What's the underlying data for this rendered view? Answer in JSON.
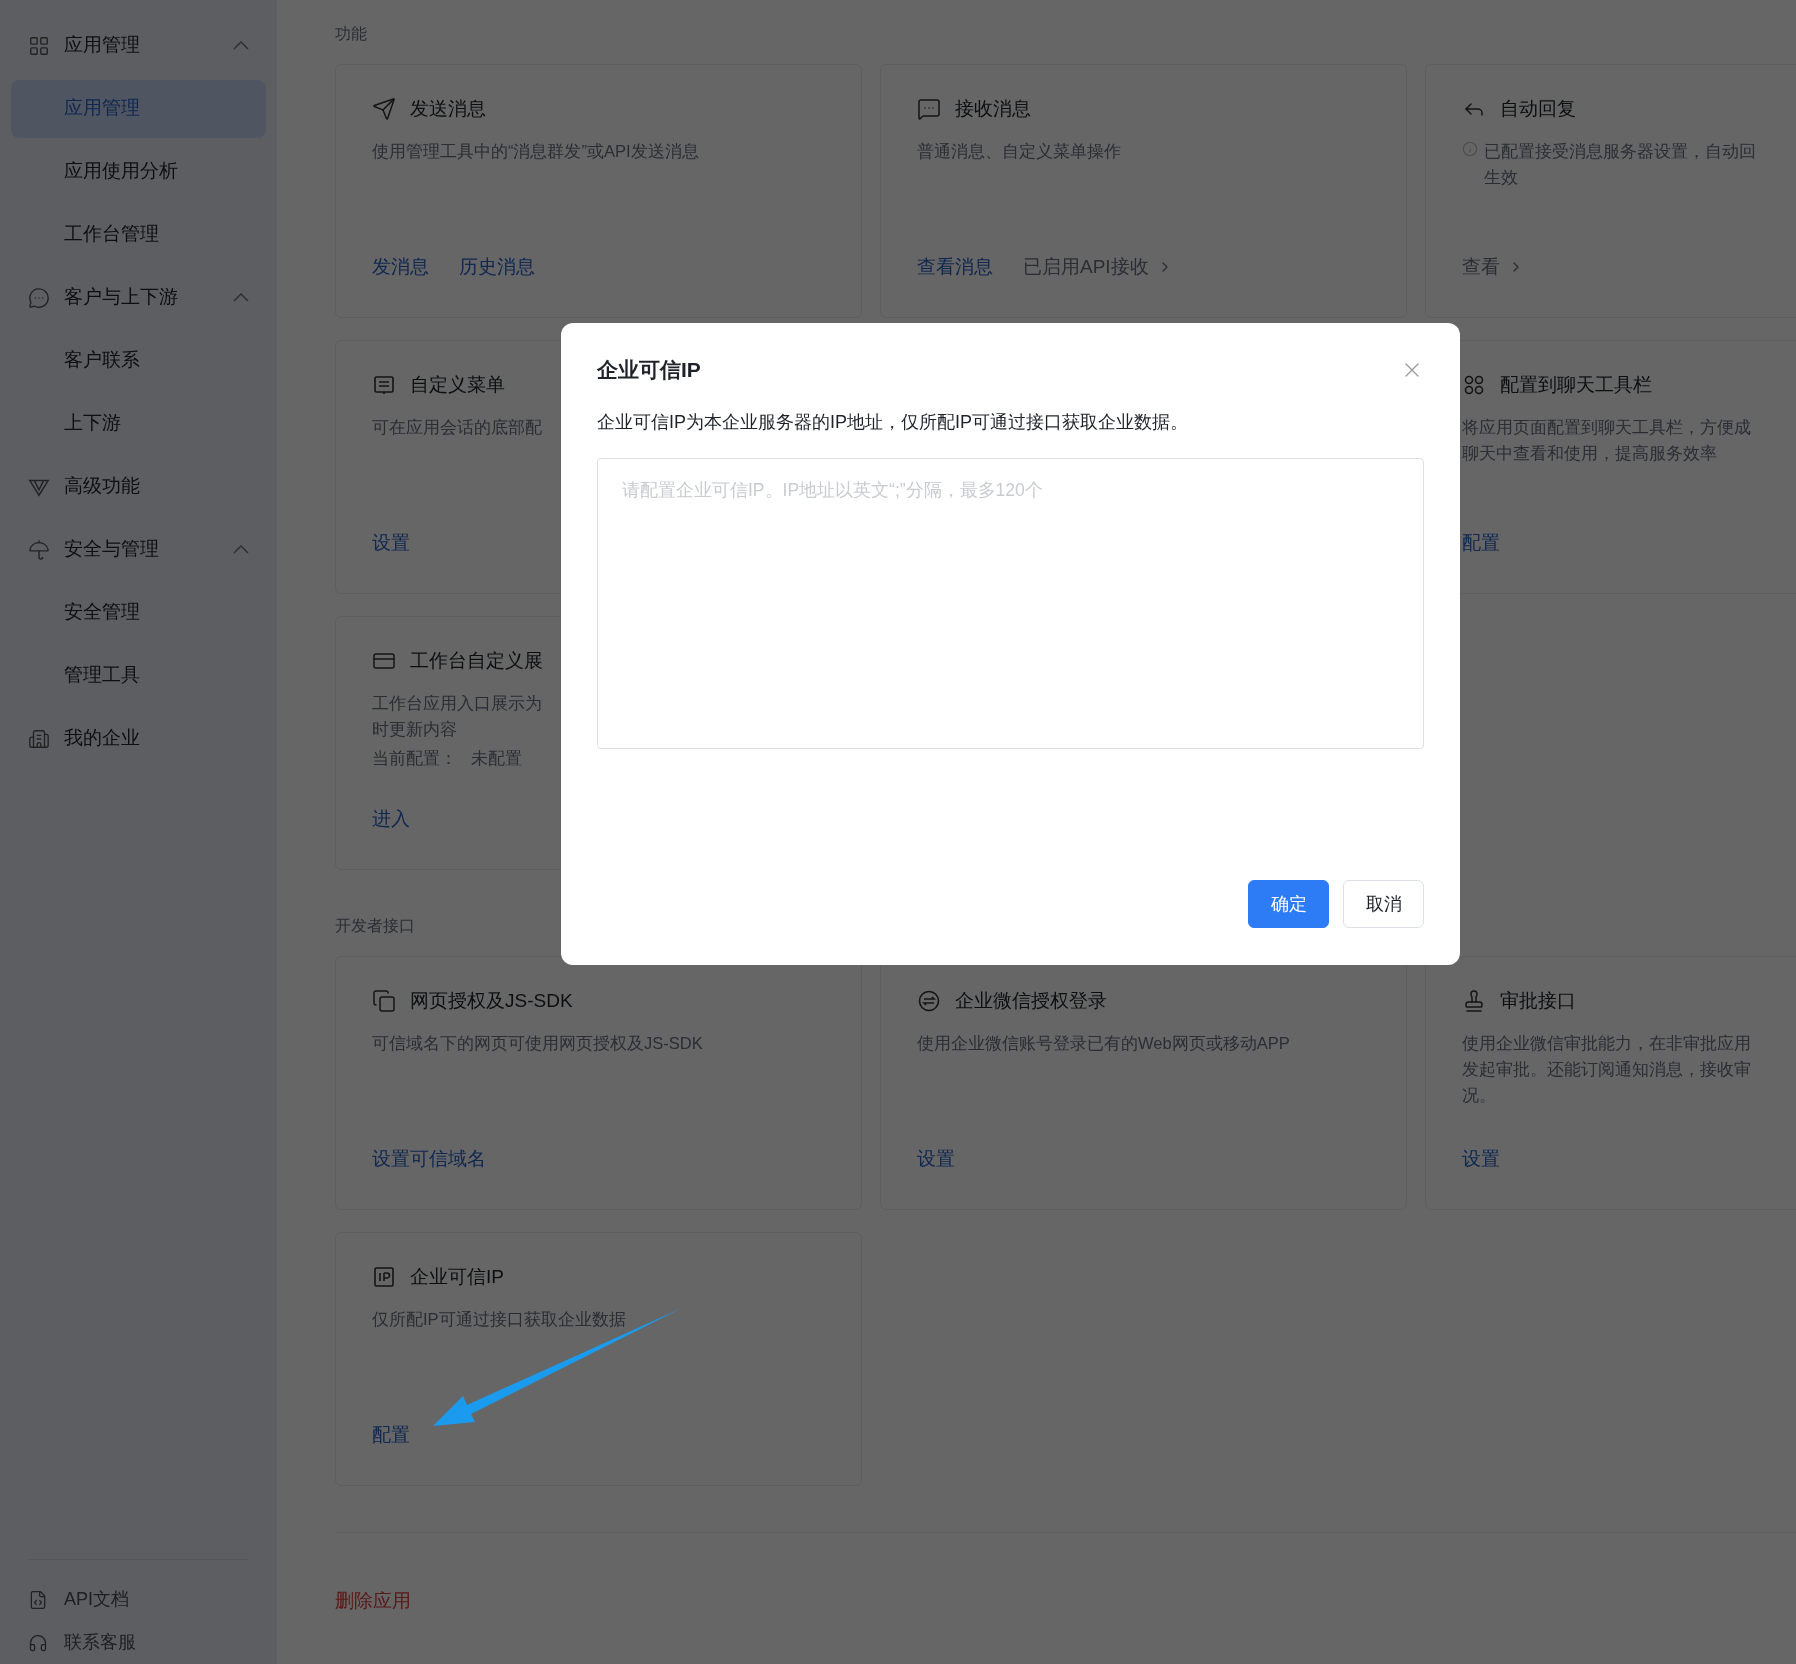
{
  "sidebar": {
    "groups": [
      {
        "label": "应用管理",
        "expanded": true,
        "children": [
          {
            "label": "应用管理",
            "selected": true
          },
          {
            "label": "应用使用分析",
            "selected": false
          },
          {
            "label": "工作台管理",
            "selected": false
          }
        ]
      },
      {
        "label": "客户与上下游",
        "expanded": true,
        "children": [
          {
            "label": "客户联系",
            "selected": false
          },
          {
            "label": "上下游",
            "selected": false
          }
        ]
      },
      {
        "label": "高级功能"
      },
      {
        "label": "安全与管理",
        "expanded": true,
        "children": [
          {
            "label": "安全管理",
            "selected": false
          },
          {
            "label": "管理工具",
            "selected": false
          }
        ]
      },
      {
        "label": "我的企业"
      }
    ],
    "footer": [
      {
        "label": "API文档"
      },
      {
        "label": "联系客服"
      }
    ]
  },
  "sections": [
    {
      "title": "功能",
      "cards": [
        {
          "title": "发送消息",
          "description": [
            "使用管理工具中的“消息群发”或API发送消息"
          ],
          "actions": [
            {
              "label": "发消息",
              "kind": "link"
            },
            {
              "label": "历史消息",
              "kind": "link"
            }
          ]
        },
        {
          "title": "接收消息",
          "description": [
            "普通消息、自定义菜单操作"
          ],
          "actions": [
            {
              "label": "查看消息",
              "kind": "link"
            },
            {
              "label": "已启用API接收",
              "kind": "more"
            }
          ]
        },
        {
          "title": "自动回复",
          "notice": true,
          "description": [
            "已配置接受消息服务器设置，自动回",
            "生效"
          ],
          "actions": [
            {
              "label": "查看",
              "kind": "more"
            }
          ]
        },
        {
          "title": "自定义菜单",
          "description": [
            "可在应用会话的底部配"
          ],
          "actions": [
            {
              "label": "设置",
              "kind": "link"
            }
          ]
        },
        {
          "title": "配置到聊天工具栏",
          "description": [
            "将应用页面配置到聊天工具栏，方便成",
            "聊天中查看和使用，提高服务效率"
          ],
          "actions": [
            {
              "label": "配置",
              "kind": "link"
            }
          ]
        },
        {
          "title": "工作台自定义展",
          "description": [
            "工作台应用入口展示为",
            "时更新内容"
          ],
          "config": {
            "label": "当前配置：",
            "value": "未配置"
          },
          "actions": [
            {
              "label": "进入",
              "kind": "link"
            }
          ]
        }
      ]
    },
    {
      "title": "开发者接口",
      "cards": [
        {
          "title": "网页授权及JS-SDK",
          "description": [
            "可信域名下的网页可使用网页授权及JS-SDK"
          ],
          "actions": [
            {
              "label": "设置可信域名",
              "kind": "link"
            }
          ]
        },
        {
          "title": "企业微信授权登录",
          "description": [
            "使用企业微信账号登录已有的Web网页或移动APP"
          ],
          "actions": [
            {
              "label": "设置",
              "kind": "link"
            }
          ]
        },
        {
          "title": "审批接口",
          "description": [
            "使用企业微信审批能力，在非审批应用",
            "发起审批。还能订阅通知消息，接收审",
            "况。"
          ],
          "actions": [
            {
              "label": "设置",
              "kind": "link"
            }
          ]
        },
        {
          "title": "企业可信IP",
          "description": [
            "仅所配IP可通过接口获取企业数据"
          ],
          "actions": [
            {
              "label": "配置",
              "kind": "link"
            }
          ]
        }
      ]
    }
  ],
  "delete_link": "删除应用",
  "dialog": {
    "title": "企业可信IP",
    "description": "企业可信IP为本企业服务器的IP地址，仅所配IP可通过接口获取企业数据。",
    "placeholder": "请配置企业可信IP。IP地址以英文“;”分隔，最多120个",
    "buttons": [
      {
        "label": "确定",
        "kind": "primary"
      },
      {
        "label": "取消",
        "kind": "secondary"
      }
    ]
  }
}
